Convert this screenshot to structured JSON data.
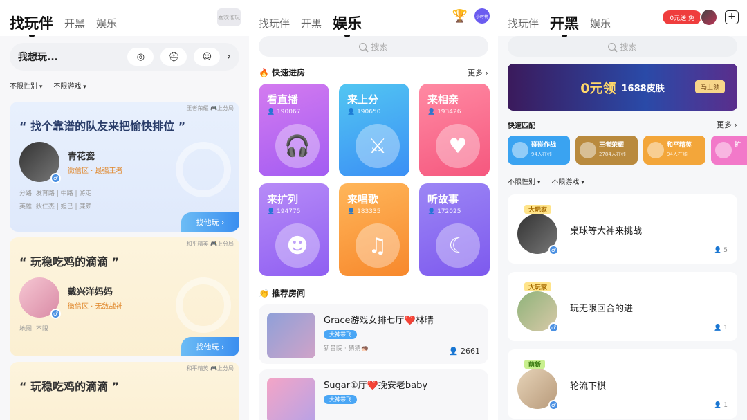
{
  "screen1": {
    "tabs": [
      "找玩伴",
      "开黑",
      "娱乐"
    ],
    "logo_text": "喜欢谁玩",
    "want_label": "我想玩...",
    "filters": [
      "不限性别",
      "不限游戏"
    ],
    "cards": [
      {
        "tag": "王者荣耀 🎮上分局",
        "title": "“ 找个靠谱的队友来把愉快排位 ”",
        "name": "青花瓷",
        "area": "微信区 · 最强王者",
        "info1": "分路: 发育路 | 中路 | 游走",
        "info2": "英雄: 狄仁杰 | 妲己 | 廉颇",
        "button": "找他玩 ›"
      },
      {
        "tag": "和平精英 🎮上分局",
        "title": "“ 玩稳吃鸡的滴滴 ”",
        "name": "戴兴洋妈妈",
        "area": "微信区 · 无敌战神",
        "info1": "地图: 不限",
        "info2": "",
        "button": "找他玩 ›"
      },
      {
        "tag": "和平精英 🎮上分局",
        "title": "“ 玩稳吃鸡的滴滴 ”"
      }
    ]
  },
  "screen2": {
    "tabs": [
      "找玩伴",
      "开黑",
      "娱乐"
    ],
    "search_placeholder": "搜索",
    "quick_title": "🔥 快速进房",
    "more": "更多 ›",
    "tiles": [
      {
        "name": "看直播",
        "count": "👤 190067",
        "icon": "🎧"
      },
      {
        "name": "来上分",
        "count": "👤 190650",
        "icon": "⚔"
      },
      {
        "name": "来相亲",
        "count": "👤 193426",
        "icon": "♥"
      },
      {
        "name": "来扩列",
        "count": "👤 194775",
        "icon": "☻"
      },
      {
        "name": "来唱歌",
        "count": "👤 183335",
        "icon": "♫"
      },
      {
        "name": "听故事",
        "count": "👤 172025",
        "icon": "☾"
      }
    ],
    "rec_title": "👏 推荐房间",
    "rooms": [
      {
        "title": "Grace游戏女排七厅❤️林晴",
        "badge": "大神带飞",
        "host": "新音院 · 猜猜🦔",
        "count": "👤 2661"
      },
      {
        "title": "Sugar①厅❤️挽安老baby",
        "badge": "大神带飞",
        "host": "",
        "count": ""
      }
    ],
    "badge_label": "小时榜"
  },
  "screen3": {
    "tabs": [
      "找玩伴",
      "开黑",
      "娱乐"
    ],
    "search_placeholder": "搜索",
    "red_pill": "0元送 免",
    "banner": {
      "title": "0元领",
      "sub": "1688皮肤",
      "btn": "马上领"
    },
    "quick_title": "快速匹配",
    "more": "更多 ›",
    "quick": [
      {
        "name": "碰碰作战",
        "count": "94人在线"
      },
      {
        "name": "王者荣耀",
        "count": "2784人在线"
      },
      {
        "name": "和平精英",
        "count": "94人在线"
      },
      {
        "name": "扩",
        "count": ""
      }
    ],
    "filters": [
      "不限性别",
      "不限游戏"
    ],
    "matches": [
      {
        "tag": "大玩家",
        "title": "桌球等大神来挑战",
        "count": "👤 5"
      },
      {
        "tag": "大玩家",
        "title": "玩无限回合的进",
        "count": "👤 1"
      },
      {
        "tag": "萌新",
        "title": "轮流下棋",
        "count": "👤 1"
      }
    ]
  }
}
